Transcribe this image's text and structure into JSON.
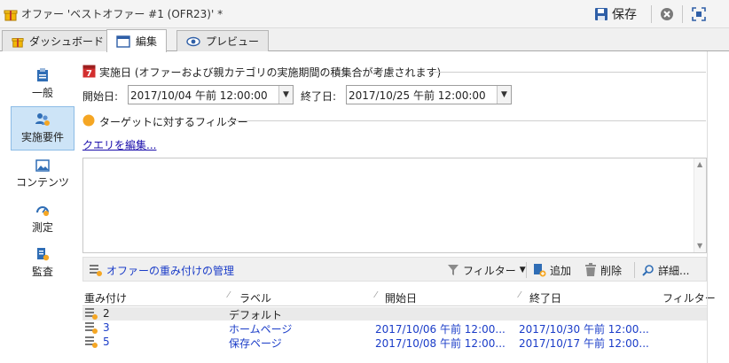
{
  "window": {
    "title": "オファー 'ベストオファー #1 (OFR23)' *",
    "save_label": "保存"
  },
  "tabs": [
    {
      "label": "ダッシュボード",
      "icon": "gift-icon"
    },
    {
      "label": "編集",
      "icon": "window-icon"
    },
    {
      "label": "プレビュー",
      "icon": "eye-icon"
    }
  ],
  "sidebar": {
    "items": [
      {
        "label": "一般",
        "icon": "clipboard-icon"
      },
      {
        "label": "実施要件",
        "icon": "users-icon"
      },
      {
        "label": "コンテンツ",
        "icon": "image-icon"
      },
      {
        "label": "測定",
        "icon": "gauge-icon"
      },
      {
        "label": "監査",
        "icon": "audit-icon"
      }
    ],
    "active_index": 1
  },
  "validity": {
    "calendar_day": "7",
    "heading": "実施日 (オファーおよび親カテゴリの実施期間の積集合が考慮されます)",
    "start_label": "開始日:",
    "start_value": "2017/10/04 午前 12:00:00",
    "end_label": "終了日:",
    "end_value": "2017/10/25 午前 12:00:00"
  },
  "filter_section": {
    "heading": "ターゲットに対するフィルター",
    "edit_link": "クエリを編集..."
  },
  "grid_toolbar": {
    "weights_label": "オファーの重み付けの管理",
    "filter_label": "フィルター",
    "add_label": "追加",
    "delete_label": "削除",
    "detail_label": "詳細..."
  },
  "grid": {
    "columns": [
      "重み付け",
      "ラベル",
      "開始日",
      "終了日",
      "フィルター"
    ],
    "rows": [
      {
        "weight": "2",
        "label": "デフォルト",
        "start": "",
        "end": "",
        "filter": ""
      },
      {
        "weight": "3",
        "label": "ホームページ",
        "start": "2017/10/06 午前 12:00...",
        "end": "2017/10/30 午前 12:00...",
        "filter": ""
      },
      {
        "weight": "5",
        "label": "保存ページ",
        "start": "2017/10/08 午前 12:00...",
        "end": "2017/10/17 午前 12:00...",
        "filter": ""
      }
    ]
  },
  "colors": {
    "accent_blue": "#1a3cc8",
    "selection": "#cde4f7",
    "calendar_red": "#d32f2f",
    "filter_orange": "#f5a623"
  }
}
